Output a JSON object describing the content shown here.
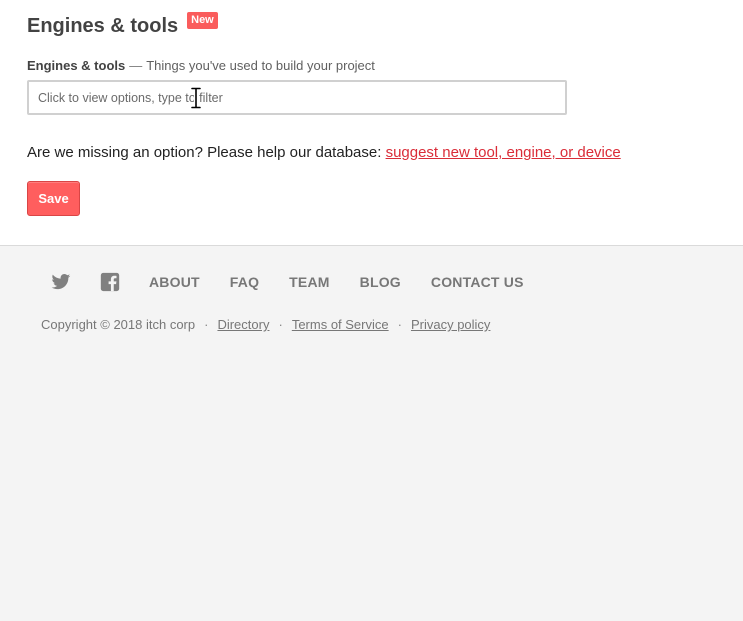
{
  "section": {
    "title": "Engines & tools",
    "badge": "New"
  },
  "field": {
    "label": "Engines & tools",
    "separator": "—",
    "hint": "Things you've used to build your project",
    "placeholder": "Click to view options, type to filter",
    "value": ""
  },
  "missing": {
    "text": "Are we missing an option? Please help our database: ",
    "link": "suggest new tool, engine, or device"
  },
  "save_label": "Save",
  "footer": {
    "social": [
      "twitter-icon",
      "facebook-icon"
    ],
    "nav": [
      "ABOUT",
      "FAQ",
      "TEAM",
      "BLOG",
      "CONTACT US"
    ],
    "copyright": "Copyright © 2018 itch corp",
    "separator": "·",
    "links": [
      "Directory",
      "Terms of Service",
      "Privacy policy"
    ]
  },
  "colors": {
    "accent": "#fa5c5c",
    "link": "#da2c38",
    "footer_bg": "#f4f4f4"
  }
}
